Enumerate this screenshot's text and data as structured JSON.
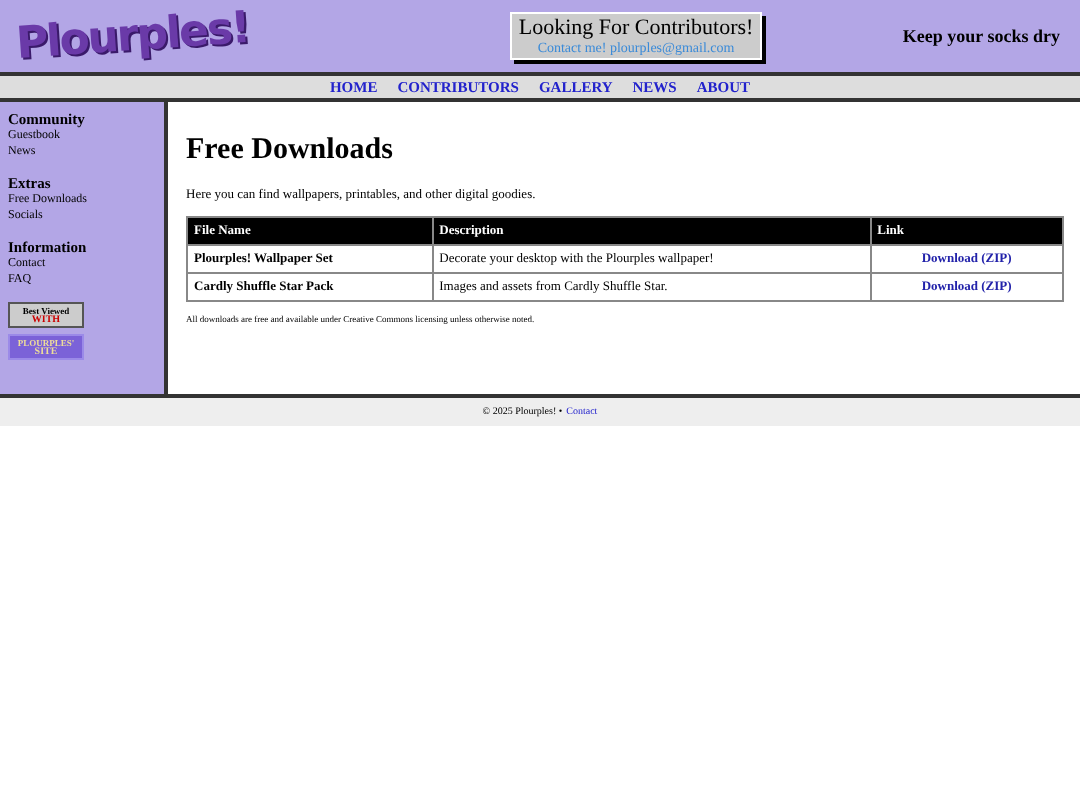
{
  "header": {
    "logo": "Plourples!",
    "banner": {
      "title": "Looking For Contributors!",
      "contact": "Contact me! plourples@gmail.com"
    },
    "tagline": "Keep your socks dry"
  },
  "nav": [
    "HOME",
    "CONTRIBUTORS",
    "GALLERY",
    "NEWS",
    "ABOUT"
  ],
  "sidebar": {
    "sections": [
      {
        "title": "Community",
        "links": [
          "Guestbook",
          "News"
        ]
      },
      {
        "title": "Extras",
        "links": [
          "Free Downloads",
          "Socials"
        ]
      },
      {
        "title": "Information",
        "links": [
          "Contact",
          "FAQ"
        ]
      }
    ],
    "badges": [
      {
        "kind": "viewed",
        "line_1": "Best Viewed",
        "line_2": "WITH"
      },
      {
        "kind": "site",
        "line_1": "PLOURPLES'",
        "line_2": "SITE"
      }
    ]
  },
  "main": {
    "title": "Free Downloads",
    "intro": "Here you can find wallpapers, printables, and other digital goodies.",
    "table": {
      "columns": [
        "File Name",
        "Description",
        "Link"
      ],
      "rows": [
        {
          "name": "Plourples! Wallpaper Set",
          "description": "Decorate your desktop with the Plourples wallpaper!",
          "link": "Download (ZIP)"
        },
        {
          "name": "Cardly Shuffle Star Pack",
          "description": "Images and assets from Cardly Shuffle Star.",
          "link": "Download (ZIP)"
        }
      ]
    },
    "note": "All downloads are free and available under Creative Commons licensing unless otherwise noted."
  },
  "footer": {
    "text": "© 2025 Plourples! •",
    "link": "Contact"
  }
}
